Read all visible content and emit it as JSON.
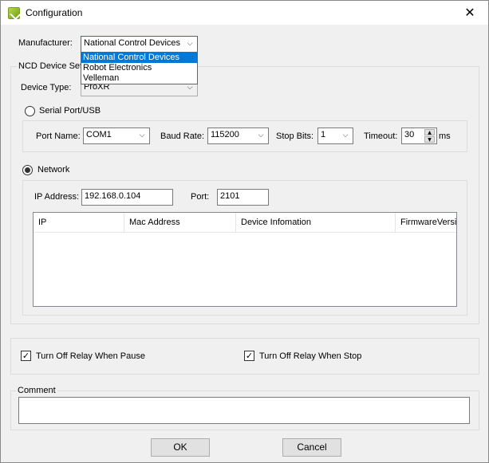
{
  "window": {
    "title": "Configuration",
    "close_glyph": "✕"
  },
  "manufacturer": {
    "label": "Manufacturer:",
    "value": "National Control Devices",
    "options": [
      "National Control Devices",
      "Robot Electronics",
      "Velleman"
    ]
  },
  "ncd_group": {
    "title": "NCD Device Set"
  },
  "device_type": {
    "label": "Device Type:",
    "value": "ProXR"
  },
  "serial": {
    "label": "Serial Port/USB",
    "port_name_label": "Port Name:",
    "port_name": "COM1",
    "baud_rate_label": "Baud Rate:",
    "baud_rate": "115200",
    "stop_bits_label": "Stop Bits:",
    "stop_bits": "1",
    "timeout_label": "Timeout:",
    "timeout": "30",
    "timeout_unit": "ms"
  },
  "network": {
    "label": "Network",
    "ip_label": "IP Address:",
    "ip_value": "192.168.0.104",
    "port_label": "Port:",
    "port_value": "2101",
    "columns": [
      "IP",
      "Mac Address",
      "Device Infomation",
      "FirmwareVersic"
    ]
  },
  "options": {
    "relay_pause": "Turn Off Relay When Pause",
    "relay_stop": "Turn Off Relay When Stop"
  },
  "comment": {
    "title": "Comment"
  },
  "buttons": {
    "ok": "OK",
    "cancel": "Cancel"
  },
  "glyphs": {
    "chevron": "⌵",
    "check": "✓",
    "up": "▲",
    "down": "▼"
  }
}
